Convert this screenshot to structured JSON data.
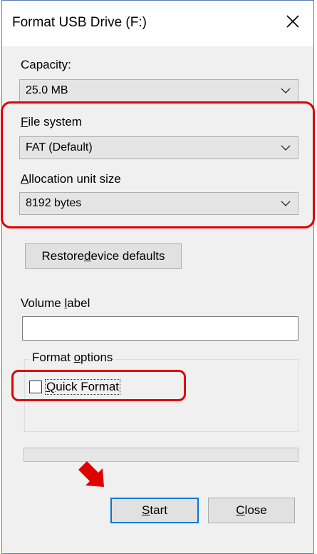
{
  "dialog": {
    "title": "Format USB Drive (F:)",
    "close_icon": "close-icon"
  },
  "capacity": {
    "label": "Capacity:",
    "value": "25.0 MB"
  },
  "file_system": {
    "label_mnemonic": "F",
    "label_rest": "ile system",
    "value": "FAT (Default)"
  },
  "allocation": {
    "label_mnemonic": "A",
    "label_rest": "llocation unit size",
    "value": "8192 bytes"
  },
  "restore_button": {
    "before": "Restore ",
    "mnemonic": "d",
    "after": "evice defaults"
  },
  "volume_label": {
    "before": "Volume ",
    "mnemonic": "l",
    "after": "abel",
    "value": ""
  },
  "format_options": {
    "legend_before": "Format ",
    "legend_mnemonic": "o",
    "legend_after": "ptions",
    "quick_format_mnemonic": "Q",
    "quick_format_rest": "uick Format",
    "quick_format_checked": false
  },
  "progress": {
    "value": 0
  },
  "buttons": {
    "start_mnemonic": "S",
    "start_rest": "tart",
    "close_mnemonic": "C",
    "close_rest": "lose"
  },
  "annotation": {
    "highlight_color": "#e00000",
    "arrow_color": "#e00000"
  }
}
